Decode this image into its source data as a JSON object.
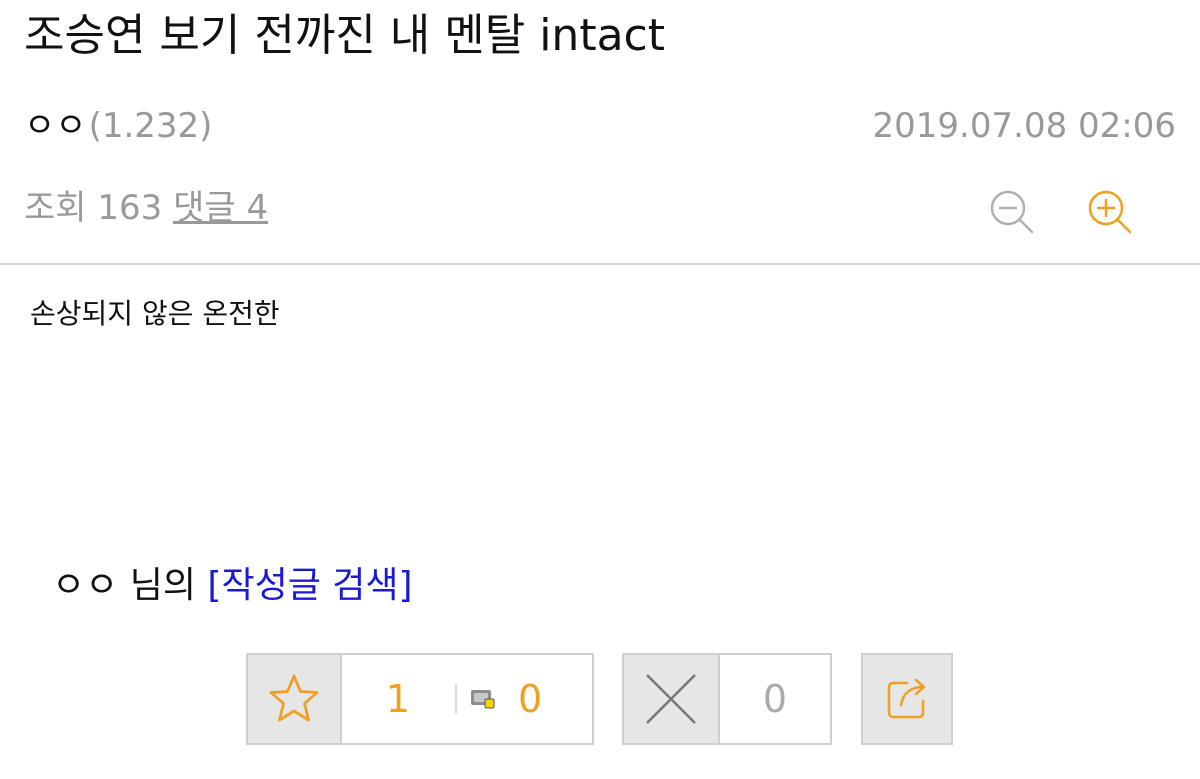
{
  "post": {
    "title": "조승연 보기 전까진 내 멘탈 intact",
    "author": "ㅇㅇ",
    "author_level": "(1.232)",
    "date": "2019.07.08 02:06",
    "views_label": "조회 163",
    "comments_label": "댓글 4",
    "body": "손상되지 않은 온전한"
  },
  "author_line": {
    "name": "ㅇㅇ",
    "suffix": "님의",
    "search_link": "[작성글 검색]"
  },
  "actions": {
    "recommend_count": "1",
    "fixed_recommend_count": "0",
    "not_recommend_count": "0"
  },
  "icons": {
    "zoom_out": "zoom-out-icon",
    "zoom_in": "zoom-in-icon",
    "recommend": "star-icon",
    "fixed_recommend": "mobile-badge-icon",
    "not_recommend": "x-icon",
    "share": "share-icon"
  },
  "colors": {
    "accent": "#f0a020",
    "link": "#1a1ad4",
    "muted": "#999999",
    "button_gray": "#e6e6e6"
  }
}
